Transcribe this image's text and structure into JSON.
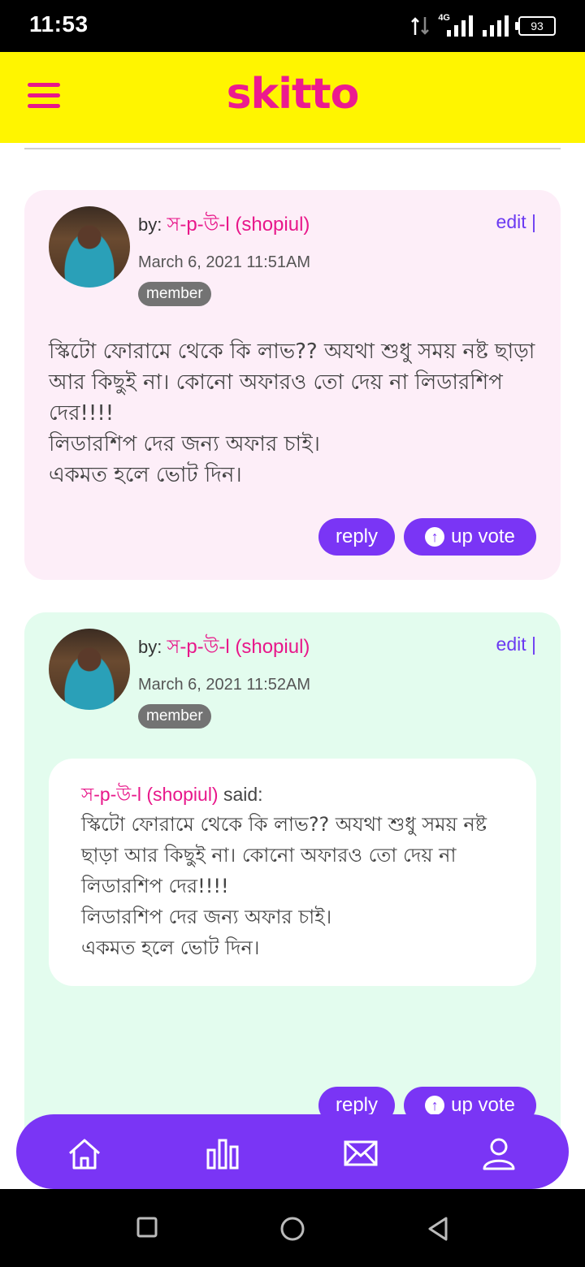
{
  "status_bar": {
    "time": "11:53",
    "network": "4G",
    "battery": "93"
  },
  "header": {
    "logo": "skitto",
    "colors": {
      "background": "#fff500",
      "brand": "#ec1b8f"
    }
  },
  "posts": [
    {
      "by_prefix": "by:",
      "author": "স-p-উ-l (shopiul)",
      "date": "March 6, 2021 11:51AM",
      "badge": "member",
      "edit_label": "edit |",
      "text": "স্কিটো ফোরামে থেকে কি লাভ?? অযথা শুধু সময় নষ্ট ছাড়া আর কিছুই না। কোনো অফারও তো দেয় না লিডারশিপ দের!!!!\nলিডারশিপ দের জন্য অফার চাই।\nএকমত হলে ভোট দিন।",
      "reply_label": "reply",
      "upvote_label": "up vote"
    },
    {
      "by_prefix": "by:",
      "author": "স-p-উ-l (shopiul)",
      "date": "March 6, 2021 11:52AM",
      "badge": "member",
      "edit_label": "edit |",
      "quote": {
        "author": "স-p-উ-l (shopiul)",
        "said": "said:",
        "text": "স্কিটো ফোরামে থেকে কি লাভ?? অযথা শুধু সময় নষ্ট ছাড়া আর কিছুই না। কোনো অফারও তো দেয় না লিডারশিপ দের!!!!\nলিডারশিপ দের জন্য অফার চাই।\nএকমত হলে ভোট দিন।"
      },
      "reply_label": "reply",
      "upvote_label": "up vote"
    }
  ],
  "bottom_nav": {
    "items": [
      {
        "icon": "home-icon"
      },
      {
        "icon": "chart-icon"
      },
      {
        "icon": "mail-icon"
      },
      {
        "icon": "profile-icon"
      }
    ],
    "color": "#7a35f5"
  }
}
